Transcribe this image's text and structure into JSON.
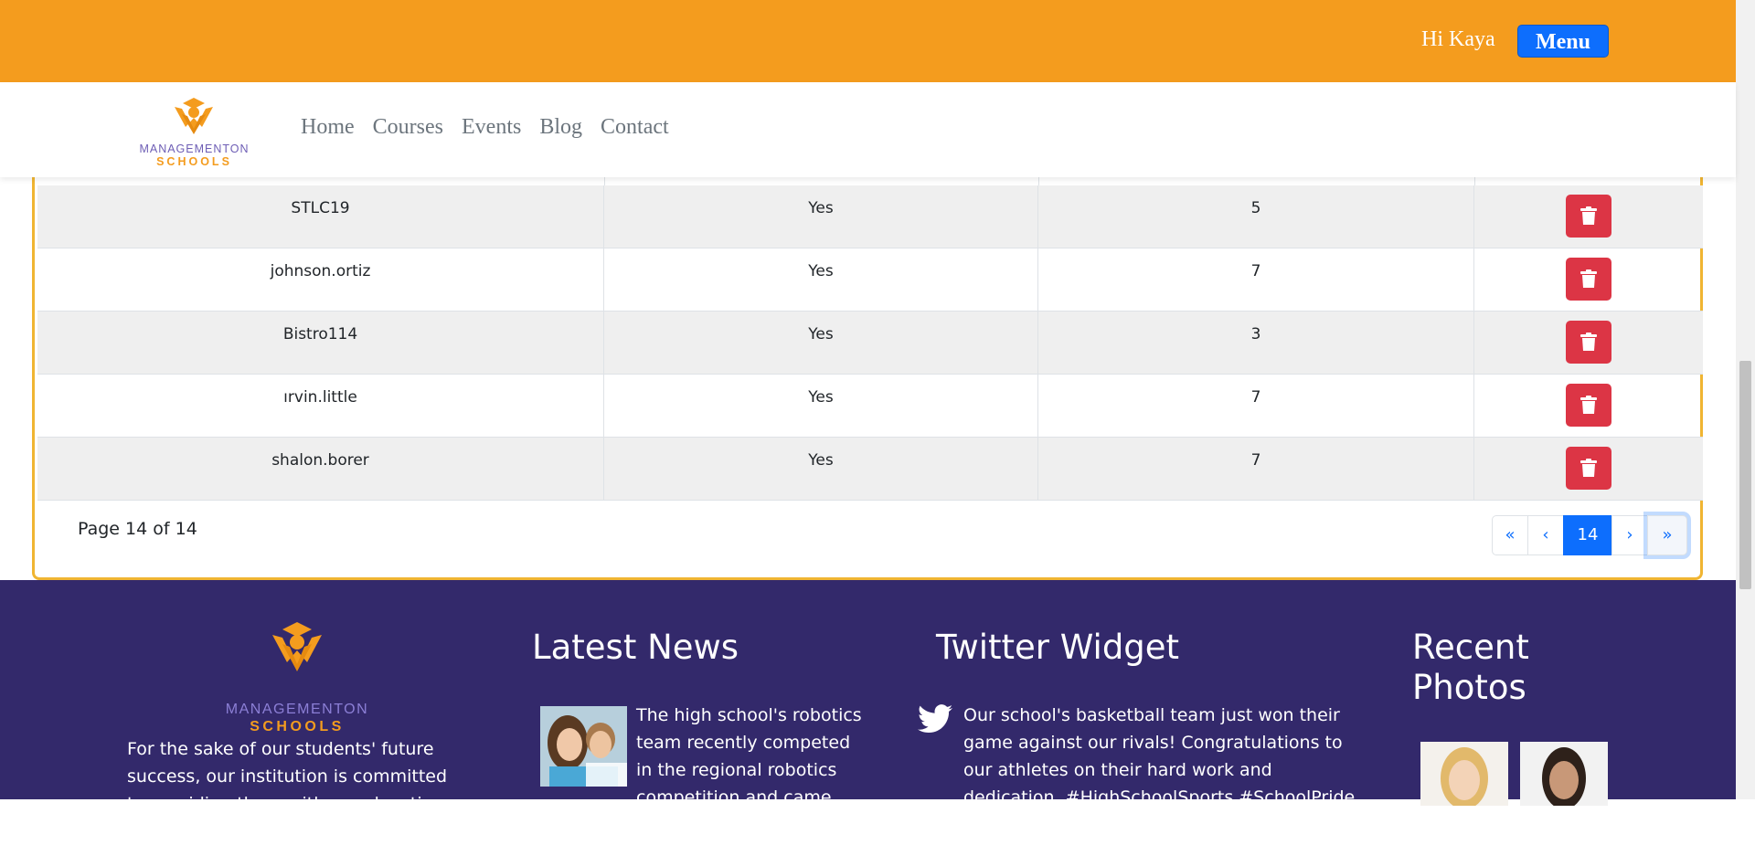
{
  "header": {
    "greeting": "Hi Kaya",
    "menu_label": "Menu",
    "brand_color": "#f49c1e",
    "button_color": "#0d6efd"
  },
  "nav": {
    "logo_line1": "MANAGEMENTON",
    "logo_line2": "SCHOOLS",
    "links": [
      "Home",
      "Courses",
      "Events",
      "Blog",
      "Contact"
    ]
  },
  "table": {
    "rows": [
      {
        "username": "STLC19",
        "active": "Yes",
        "count": "5"
      },
      {
        "username": "johnson.ortiz",
        "active": "Yes",
        "count": "7"
      },
      {
        "username": "Bistro114",
        "active": "Yes",
        "count": "3"
      },
      {
        "username": "ırvin.little",
        "active": "Yes",
        "count": "7"
      },
      {
        "username": "shalon.borer",
        "active": "Yes",
        "count": "7"
      }
    ],
    "delete_icon": "trash-icon",
    "delete_color": "#dc3545"
  },
  "pagination": {
    "page_text": "Page 14 of 14",
    "first": "«",
    "prev": "‹",
    "current": "14",
    "next": "›",
    "last": "»"
  },
  "footer": {
    "logo_line1": "MANAGEMENTON",
    "logo_line2": "SCHOOLS",
    "about_text": "For the sake of our students' future success, our institution is committed to providing them with an education that",
    "latest_news_heading": "Latest News",
    "news_text": "The high school's robotics team recently competed in the regional robotics competition and came out",
    "twitter_heading": "Twitter Widget",
    "tweet_text": "Our school's basketball team just won their game against our rivals! Congratulations to our athletes on their hard work and dedication. #HighSchoolSports #SchoolPride #Victory",
    "photos_heading_line1": "Recent",
    "photos_heading_line2": "Photos",
    "background_color": "#33296b"
  }
}
